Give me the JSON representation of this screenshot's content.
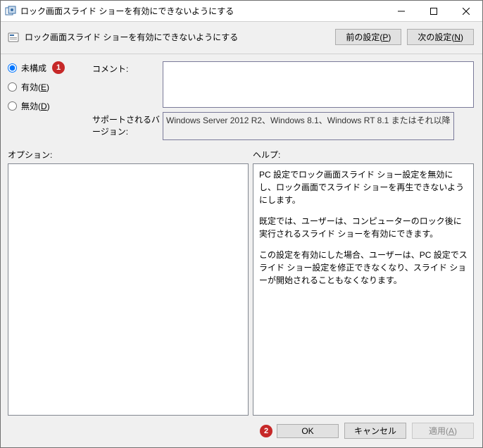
{
  "window": {
    "title": "ロック画面スライド ショーを有効にできないようにする"
  },
  "header": {
    "title": "ロック画面スライド ショーを有効にできないようにする",
    "prev_label": "前の設定(",
    "prev_key": "P",
    "prev_close": ")",
    "next_label": "次の設定(",
    "next_key": "N",
    "next_close": ")"
  },
  "radios": {
    "not_configured": "未構成",
    "enabled": "有効(",
    "enabled_key": "E",
    "enabled_close": ")",
    "disabled": "無効(",
    "disabled_key": "D",
    "disabled_close": ")",
    "selected": "not_configured"
  },
  "meta": {
    "comment_label": "コメント:",
    "comment_value": "",
    "supported_label": "サポートされるバージョン:",
    "supported_value": "Windows Server 2012 R2、Windows 8.1、Windows RT 8.1 またはそれ以降"
  },
  "sections": {
    "options_label": "オプション:",
    "help_label": "ヘルプ:"
  },
  "help": {
    "p1": "PC 設定でロック画面スライド ショー設定を無効にし、ロック画面でスライド ショーを再生できないようにします。",
    "p2": "既定では、ユーザーは、コンピューターのロック後に実行されるスライド ショーを有効にできます。",
    "p3": "この設定を有効にした場合、ユーザーは、PC 設定でスライド ショー設定を修正できなくなり、スライド ショーが開始されることもなくなります。"
  },
  "footer": {
    "ok": "OK",
    "cancel": "キャンセル",
    "apply": "適用(",
    "apply_key": "A",
    "apply_close": ")"
  },
  "annotations": {
    "a1": "1",
    "a2": "2"
  }
}
